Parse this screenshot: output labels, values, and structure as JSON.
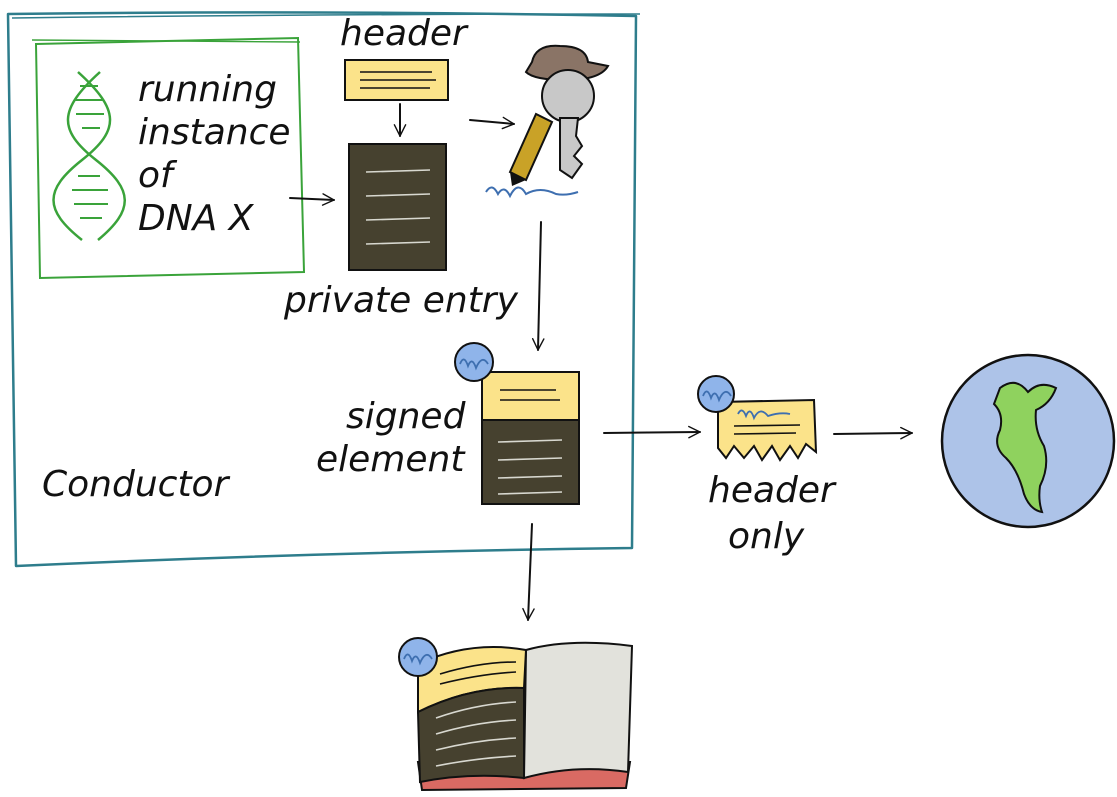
{
  "labels": {
    "header": "header",
    "running_line1": "running",
    "running_line2": "instance",
    "running_line3": "of",
    "running_line4": "DNA X",
    "private_entry": "private entry",
    "signed_line1": "signed",
    "signed_line2": "element",
    "conductor": "Conductor",
    "header_only_line1": "header",
    "header_only_line2": "only"
  },
  "colors": {
    "conductor_border": "#2e7d8c",
    "dna_border": "#3aa33a",
    "dna_strand": "#3aa33a",
    "header_yellow": "#fbe38a",
    "entry_dark": "#46412f",
    "entry_lines": "#d8d8d0",
    "signature_blue": "#3e6fb0",
    "seal_blue": "#8fb4ea",
    "key_gray": "#c8c8c8",
    "hat_brown": "#8a7466",
    "pencil_gold": "#c9a227",
    "earth_ocean": "#adc3e8",
    "earth_land": "#8fd25e",
    "book_page": "#e2e2dc",
    "book_cover_red": "#d96a63"
  },
  "icons": {
    "dna": "dna-helix-icon",
    "signing": "key-pencil-hat-icon",
    "network": "earth-globe-icon",
    "chain": "open-book-icon",
    "seal": "signature-seal-icon"
  }
}
